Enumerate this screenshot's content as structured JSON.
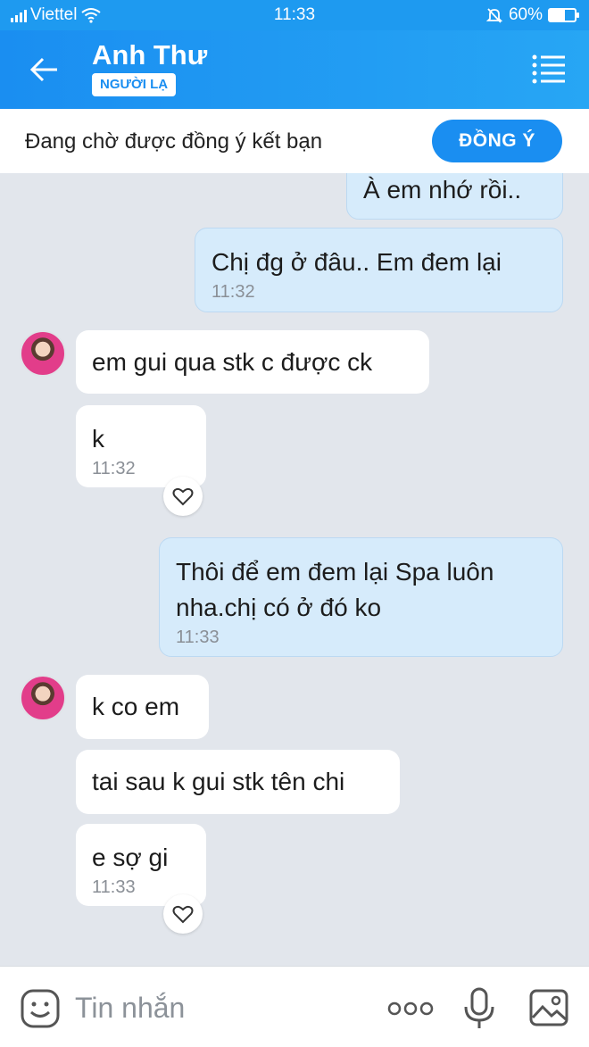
{
  "status_bar": {
    "carrier": "Viettel",
    "time": "11:33",
    "battery": "60%",
    "battery_level": 0.6
  },
  "header": {
    "name": "Anh Thư",
    "badge": "NGƯỜI LẠ",
    "back_icon": "arrow-left-icon",
    "menu_icon": "menu-icon"
  },
  "pending": {
    "text": "Đang chờ được đồng ý kết bạn",
    "accept_label": "ĐỒNG Ý"
  },
  "messages": [
    {
      "dir": "out",
      "text": "À em nhớ rồi..",
      "time": ""
    },
    {
      "dir": "out",
      "text": "Chị đg ở đâu.. Em đem lại",
      "time": "11:32"
    },
    {
      "dir": "in",
      "text": "em gui qua stk c được ck",
      "time": ""
    },
    {
      "dir": "in",
      "text": "k",
      "time": "11:32"
    },
    {
      "dir": "out",
      "text": "Thôi để em đem lại Spa luôn nha.chị có ở đó ko",
      "line1": "Thôi để em đem lại Spa luôn",
      "line2": "nha.chị có ở đó ko",
      "time": "11:33"
    },
    {
      "dir": "in",
      "text": "k co em",
      "time": ""
    },
    {
      "dir": "in",
      "text": "tai sau k gui stk tên chi",
      "time": ""
    },
    {
      "dir": "in",
      "text": "e sợ gi",
      "time": "11:33"
    }
  ],
  "input": {
    "placeholder": "Tin nhắn",
    "sticker_icon": "sticker-icon",
    "more_icon": "more-icon",
    "mic_icon": "microphone-icon",
    "image_icon": "image-icon"
  },
  "colors": {
    "accent": "#1a8ef1",
    "outgoing_bubble": "#d6ebfb",
    "incoming_bubble": "#ffffff",
    "chat_background": "#e2e6ec"
  }
}
